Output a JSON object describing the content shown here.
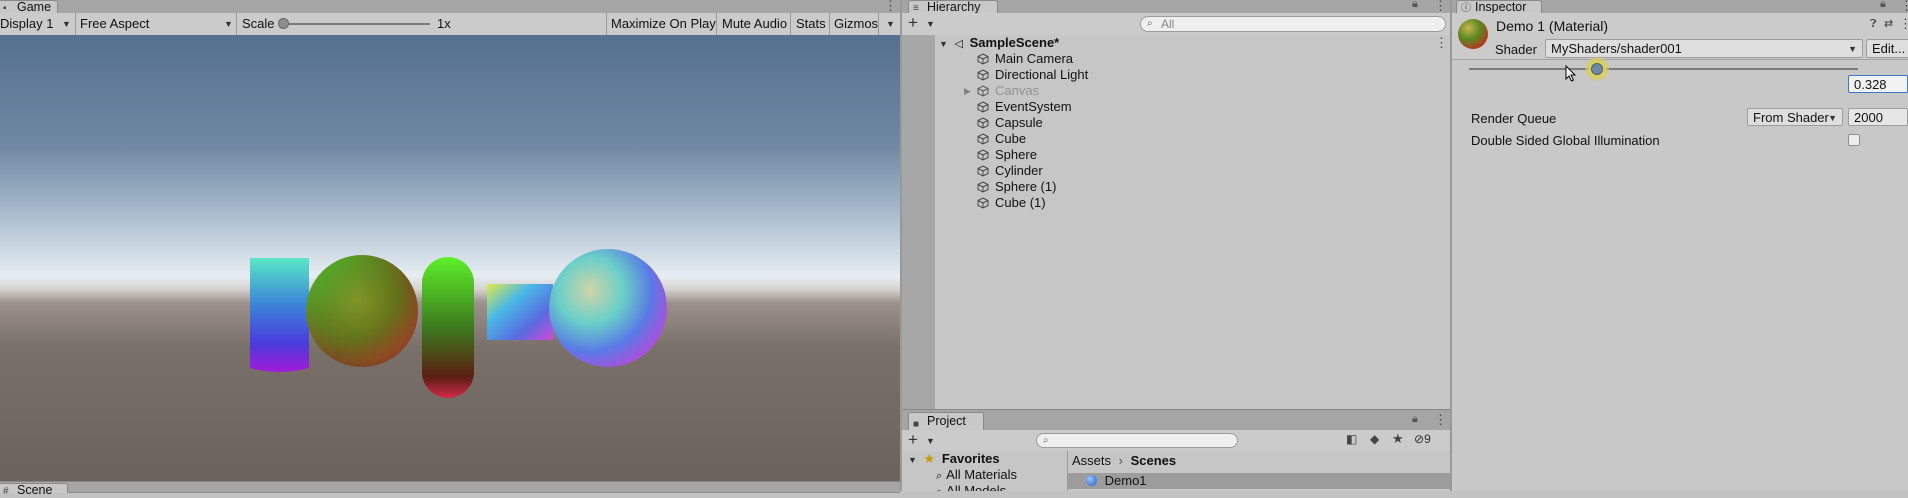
{
  "game": {
    "tab_label": "Game",
    "display": "Display 1",
    "aspect": "Free Aspect",
    "scale_label": "Scale",
    "scale_value": "1x",
    "scale_fraction": 0.0,
    "maximize": "Maximize On Play",
    "mute": "Mute Audio",
    "stats": "Stats",
    "gizmos": "Gizmos"
  },
  "scene_tab": {
    "label": "Scene"
  },
  "hierarchy": {
    "tab_label": "Hierarchy",
    "search_placeholder": "All",
    "scene_name": "SampleScene*",
    "items": [
      {
        "label": "Main Camera"
      },
      {
        "label": "Directional Light"
      },
      {
        "label": "Canvas"
      },
      {
        "label": "EventSystem"
      },
      {
        "label": "Capsule"
      },
      {
        "label": "Cube"
      },
      {
        "label": "Sphere"
      },
      {
        "label": "Cylinder"
      },
      {
        "label": "Sphere (1)"
      },
      {
        "label": "Cube (1)"
      }
    ]
  },
  "project": {
    "tab_label": "Project",
    "hidden_count": "9",
    "favorites_label": "Favorites",
    "favorites": [
      "All Materials",
      "All Models"
    ],
    "breadcrumb": [
      "Assets",
      "Scenes"
    ],
    "assets": [
      "Demo1"
    ]
  },
  "inspector": {
    "tab_label": "Inspector",
    "title": "Demo 1 (Material)",
    "shader_label": "Shader",
    "shader_value": "MyShaders/shader001",
    "edit_label": "Edit...",
    "slider_value": "0.328",
    "slider_fraction": 0.328,
    "render_queue_label": "Render Queue",
    "render_queue_mode": "From Shader",
    "render_queue_value": "2000",
    "double_sided_label": "Double Sided Global Illumination",
    "double_sided_checked": false
  },
  "colors": {
    "sky_top": "#5a7394",
    "horizon": "#dfe8ef",
    "ground": "#6b625c",
    "selection": "#9a9a9a"
  }
}
